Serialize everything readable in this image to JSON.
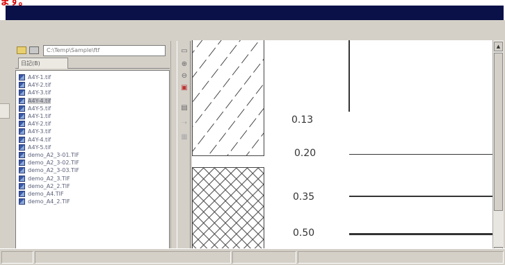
{
  "top_mark": "ます。",
  "path_field": "C:\\Temp\\Sample\\ftf",
  "tab_label": "日記(B)",
  "files": [
    "A4Y-1.tif",
    "A4Y-2.tif",
    "A4Y-3.tif",
    "A4Y-4.tif",
    "A4Y-5.tif",
    "A4Y-1.tif",
    "A4Y-2.tif",
    "A4Y-3.tif",
    "A4Y-4.tif",
    "A4Y-5.tif",
    "demo_A2_3-01.TIF",
    "demo_A2_3-02.TIF",
    "demo_A2_3-03.TIF",
    "demo_A2_3.TIF",
    "demo_A2_2.TIF",
    "demo_A4.TIF",
    "demo_A4_2.TIF"
  ],
  "selected_index": 3,
  "line_weights": {
    "w1": "0.13",
    "w2": "0.20",
    "w3": "0.35",
    "w4": "0.50"
  },
  "icons": {
    "folder": "folder-icon",
    "drive": "drive-icon",
    "file": "tif-file-icon",
    "toolbar": [
      "select-rect-icon",
      "zoom-in-icon",
      "zoom-out-icon",
      "fit-page-icon",
      "page-view-icon",
      "arrow-icon",
      "print-icon"
    ]
  },
  "colors": {
    "titlebar": "#0a1048",
    "face": "#d4d0c8",
    "top_mark": "#d80000"
  }
}
